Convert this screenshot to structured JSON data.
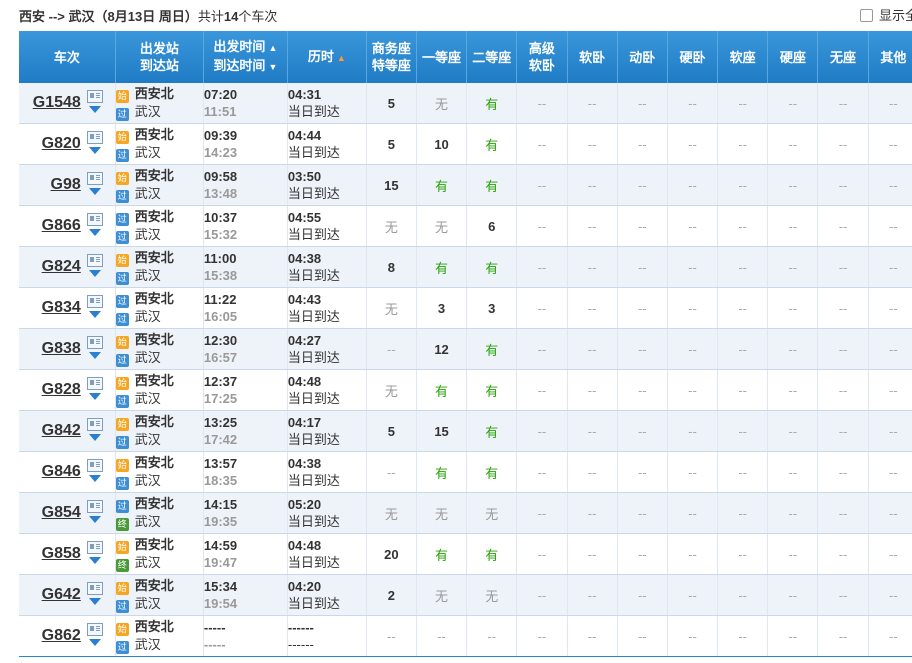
{
  "route": {
    "from": "西安",
    "arrow": " --> ",
    "to": "武汉",
    "date": "（8月13日  周日）",
    "total_prefix": "共计",
    "total_count": "14",
    "total_suffix": "个车次"
  },
  "show_all_label": "显示全",
  "headers": {
    "train": "车次",
    "station_from": "出发站",
    "station_to": "到达站",
    "time_dep": "出发时间",
    "time_arr": "到达时间",
    "duration": "历时",
    "seats": [
      [
        "商务座",
        "特等座"
      ],
      [
        "一等座"
      ],
      [
        "二等座"
      ],
      [
        "高级",
        "软卧"
      ],
      [
        "软卧"
      ],
      [
        "动卧"
      ],
      [
        "硬卧"
      ],
      [
        "软座"
      ],
      [
        "硬座"
      ],
      [
        "无座"
      ],
      [
        "其他"
      ]
    ]
  },
  "badge_labels": {
    "shi": "始",
    "guo": "过",
    "zhong": "终"
  },
  "trains": [
    {
      "no": "G1548",
      "from": "西安北",
      "from_type": "shi",
      "to": "武汉",
      "to_type": "guo",
      "dep": "07:20",
      "arr": "11:51",
      "dur": "04:31",
      "day": "当日到达",
      "seats": [
        "5",
        "无",
        "有",
        "--",
        "--",
        "--",
        "--",
        "--",
        "--",
        "--",
        "--"
      ]
    },
    {
      "no": "G820",
      "from": "西安北",
      "from_type": "shi",
      "to": "武汉",
      "to_type": "guo",
      "dep": "09:39",
      "arr": "14:23",
      "dur": "04:44",
      "day": "当日到达",
      "seats": [
        "5",
        "10",
        "有",
        "--",
        "--",
        "--",
        "--",
        "--",
        "--",
        "--",
        "--"
      ]
    },
    {
      "no": "G98",
      "from": "西安北",
      "from_type": "shi",
      "to": "武汉",
      "to_type": "guo",
      "dep": "09:58",
      "arr": "13:48",
      "dur": "03:50",
      "day": "当日到达",
      "seats": [
        "15",
        "有",
        "有",
        "--",
        "--",
        "--",
        "--",
        "--",
        "--",
        "--",
        "--"
      ]
    },
    {
      "no": "G866",
      "from": "西安北",
      "from_type": "guo",
      "to": "武汉",
      "to_type": "guo",
      "dep": "10:37",
      "arr": "15:32",
      "dur": "04:55",
      "day": "当日到达",
      "seats": [
        "无",
        "无",
        "6",
        "--",
        "--",
        "--",
        "--",
        "--",
        "--",
        "--",
        "--"
      ]
    },
    {
      "no": "G824",
      "from": "西安北",
      "from_type": "shi",
      "to": "武汉",
      "to_type": "guo",
      "dep": "11:00",
      "arr": "15:38",
      "dur": "04:38",
      "day": "当日到达",
      "seats": [
        "8",
        "有",
        "有",
        "--",
        "--",
        "--",
        "--",
        "--",
        "--",
        "--",
        "--"
      ]
    },
    {
      "no": "G834",
      "from": "西安北",
      "from_type": "guo",
      "to": "武汉",
      "to_type": "guo",
      "dep": "11:22",
      "arr": "16:05",
      "dur": "04:43",
      "day": "当日到达",
      "seats": [
        "无",
        "3",
        "3",
        "--",
        "--",
        "--",
        "--",
        "--",
        "--",
        "--",
        "--"
      ]
    },
    {
      "no": "G838",
      "from": "西安北",
      "from_type": "shi",
      "to": "武汉",
      "to_type": "guo",
      "dep": "12:30",
      "arr": "16:57",
      "dur": "04:27",
      "day": "当日到达",
      "seats": [
        "--",
        "12",
        "有",
        "--",
        "--",
        "--",
        "--",
        "--",
        "--",
        "--",
        "--"
      ]
    },
    {
      "no": "G828",
      "from": "西安北",
      "from_type": "shi",
      "to": "武汉",
      "to_type": "guo",
      "dep": "12:37",
      "arr": "17:25",
      "dur": "04:48",
      "day": "当日到达",
      "seats": [
        "无",
        "有",
        "有",
        "--",
        "--",
        "--",
        "--",
        "--",
        "--",
        "--",
        "--"
      ]
    },
    {
      "no": "G842",
      "from": "西安北",
      "from_type": "shi",
      "to": "武汉",
      "to_type": "guo",
      "dep": "13:25",
      "arr": "17:42",
      "dur": "04:17",
      "day": "当日到达",
      "seats": [
        "5",
        "15",
        "有",
        "--",
        "--",
        "--",
        "--",
        "--",
        "--",
        "--",
        "--"
      ]
    },
    {
      "no": "G846",
      "from": "西安北",
      "from_type": "shi",
      "to": "武汉",
      "to_type": "guo",
      "dep": "13:57",
      "arr": "18:35",
      "dur": "04:38",
      "day": "当日到达",
      "seats": [
        "--",
        "有",
        "有",
        "--",
        "--",
        "--",
        "--",
        "--",
        "--",
        "--",
        "--"
      ]
    },
    {
      "no": "G854",
      "from": "西安北",
      "from_type": "guo",
      "to": "武汉",
      "to_type": "zhong",
      "dep": "14:15",
      "arr": "19:35",
      "dur": "05:20",
      "day": "当日到达",
      "seats": [
        "无",
        "无",
        "无",
        "--",
        "--",
        "--",
        "--",
        "--",
        "--",
        "--",
        "--"
      ]
    },
    {
      "no": "G858",
      "from": "西安北",
      "from_type": "shi",
      "to": "武汉",
      "to_type": "zhong",
      "dep": "14:59",
      "arr": "19:47",
      "dur": "04:48",
      "day": "当日到达",
      "seats": [
        "20",
        "有",
        "有",
        "--",
        "--",
        "--",
        "--",
        "--",
        "--",
        "--",
        "--"
      ]
    },
    {
      "no": "G642",
      "from": "西安北",
      "from_type": "shi",
      "to": "武汉",
      "to_type": "guo",
      "dep": "15:34",
      "arr": "19:54",
      "dur": "04:20",
      "day": "当日到达",
      "seats": [
        "2",
        "无",
        "无",
        "--",
        "--",
        "--",
        "--",
        "--",
        "--",
        "--",
        "--"
      ]
    },
    {
      "no": "G862",
      "from": "西安北",
      "from_type": "shi",
      "to": "武汉",
      "to_type": "guo",
      "dep": "-----",
      "arr": "-----",
      "dur": "------",
      "day": "------",
      "seats": [
        "--",
        "--",
        "--",
        "--",
        "--",
        "--",
        "--",
        "--",
        "--",
        "--",
        "--"
      ]
    }
  ]
}
